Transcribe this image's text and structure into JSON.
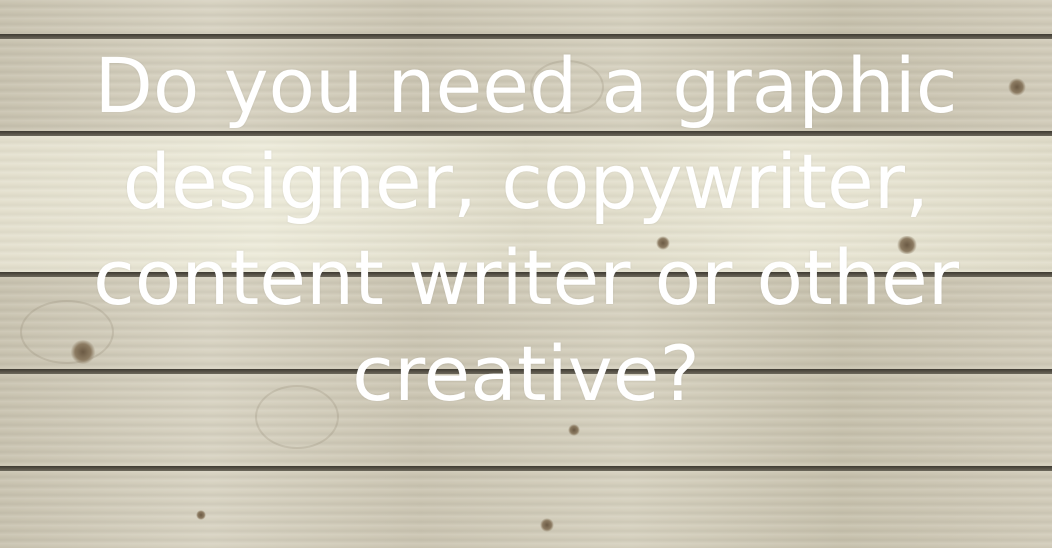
{
  "hero": {
    "headline": "Do you need a graphic designer, copywriter, content writer or other creative?"
  },
  "colors": {
    "text": "#ffffff",
    "wood_light": "#e6e2d0",
    "wood_gray": "#cfc9b6",
    "plank_gap": "#3e3a32"
  }
}
